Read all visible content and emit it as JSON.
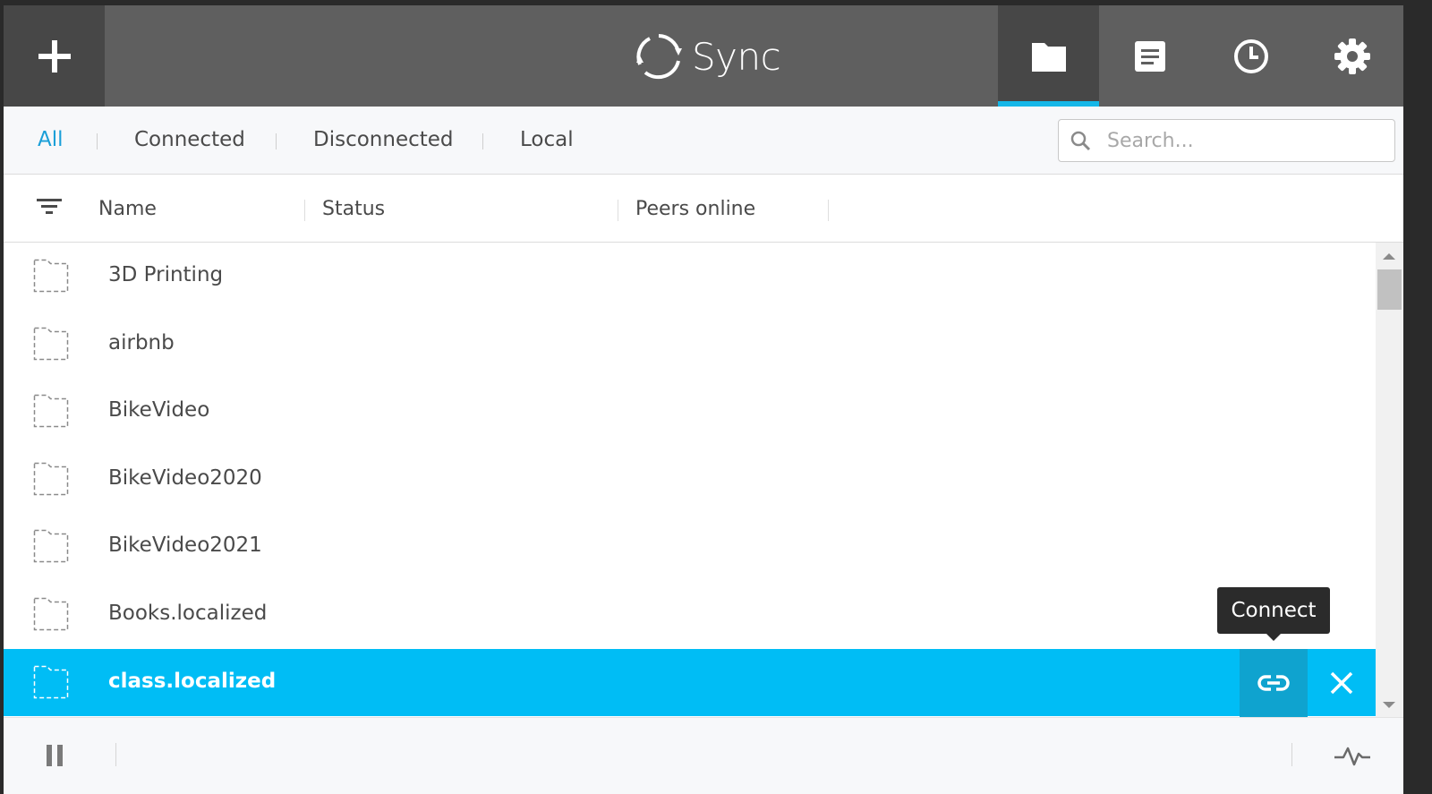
{
  "app": {
    "title": "Sync"
  },
  "colors": {
    "accent": "#15b7e8",
    "selected_row": "#00bdf5",
    "topbar": "#5f5f5f",
    "topbar_dark": "#474747"
  },
  "header": {
    "add_icon": "plus-icon",
    "nav": [
      {
        "name": "folders",
        "icon": "folder-icon",
        "active": true
      },
      {
        "name": "transfers",
        "icon": "document-icon",
        "active": false
      },
      {
        "name": "history",
        "icon": "clock-icon",
        "active": false
      },
      {
        "name": "settings",
        "icon": "gear-icon",
        "active": false
      }
    ]
  },
  "filters": {
    "tabs": [
      "All",
      "Connected",
      "Disconnected",
      "Local"
    ],
    "active": "All",
    "search_placeholder": "Search..."
  },
  "columns": [
    "Name",
    "Status",
    "Peers online"
  ],
  "folders": [
    {
      "name": "3D Printing",
      "selected": false
    },
    {
      "name": "airbnb",
      "selected": false
    },
    {
      "name": "BikeVideo",
      "selected": false
    },
    {
      "name": "BikeVideo2020",
      "selected": false
    },
    {
      "name": "BikeVideo2021",
      "selected": false
    },
    {
      "name": "Books.localized",
      "selected": false
    },
    {
      "name": "class.localized",
      "selected": true
    }
  ],
  "tooltip": {
    "text": "Connect"
  },
  "footer": {
    "pause_icon": "pause-icon",
    "activity_icon": "activity-icon"
  }
}
